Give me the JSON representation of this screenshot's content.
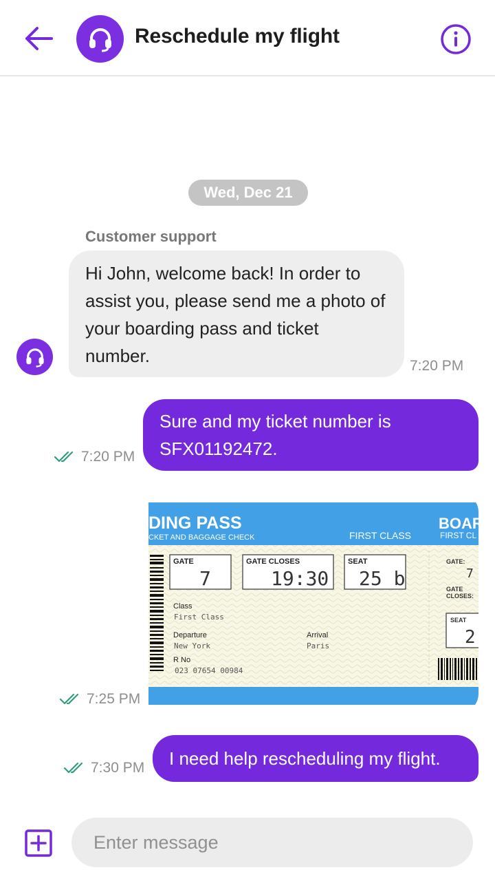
{
  "colors": {
    "accent": "#7529dc",
    "check": "#2f9e7e",
    "incoming_bg": "#eeeeee",
    "date_pill": "#c4c4c4"
  },
  "header": {
    "title": "Reschedule my flight",
    "back_icon": "arrow-left-icon",
    "avatar_icon": "headset-icon",
    "info_icon": "info-icon"
  },
  "chat": {
    "date": "Wed, Dec 21",
    "messages": [
      {
        "direction": "incoming",
        "sender": "Customer support",
        "text": "Hi John, welcome back! In order to assist you, please send me a photo of your boarding pass and ticket number.",
        "time": "7:20 PM"
      },
      {
        "direction": "outgoing",
        "text": "Sure and my ticket number is SFX01192472.",
        "time": "7:20 PM",
        "status": "read"
      },
      {
        "direction": "outgoing",
        "type": "image",
        "time": "7:25 PM",
        "status": "read",
        "boarding_pass": {
          "title": "DING PASS",
          "subtitle": "CKET AND BAGGAGE CHECK",
          "class_header": "FIRST CLASS",
          "stub_title": "BOAR",
          "stub_class": "FIRST CL",
          "gate_label": "GATE",
          "gate": "7",
          "gate_closes_label": "GATE CLOSES",
          "gate_closes": "19:30",
          "seat_label": "SEAT",
          "seat": "25 b",
          "class_label": "Class",
          "class_value": "First Class",
          "departure_label": "Departure",
          "departure": "New York",
          "arrival_label": "Arrival",
          "arrival": "Paris",
          "rno_label": "R No",
          "rno": "023 07654 00984",
          "stub_gate_label": "GATE:",
          "stub_gate": "7",
          "stub_closes_label_1": "GATE",
          "stub_closes_label_2": "CLOSES:",
          "stub_seat_label": "SEAT",
          "stub_seat": "2"
        }
      },
      {
        "direction": "outgoing",
        "text": "I need help rescheduling my flight.",
        "time": "7:30 PM",
        "status": "read"
      }
    ]
  },
  "composer": {
    "placeholder": "Enter message",
    "add_icon": "add-square-icon"
  }
}
